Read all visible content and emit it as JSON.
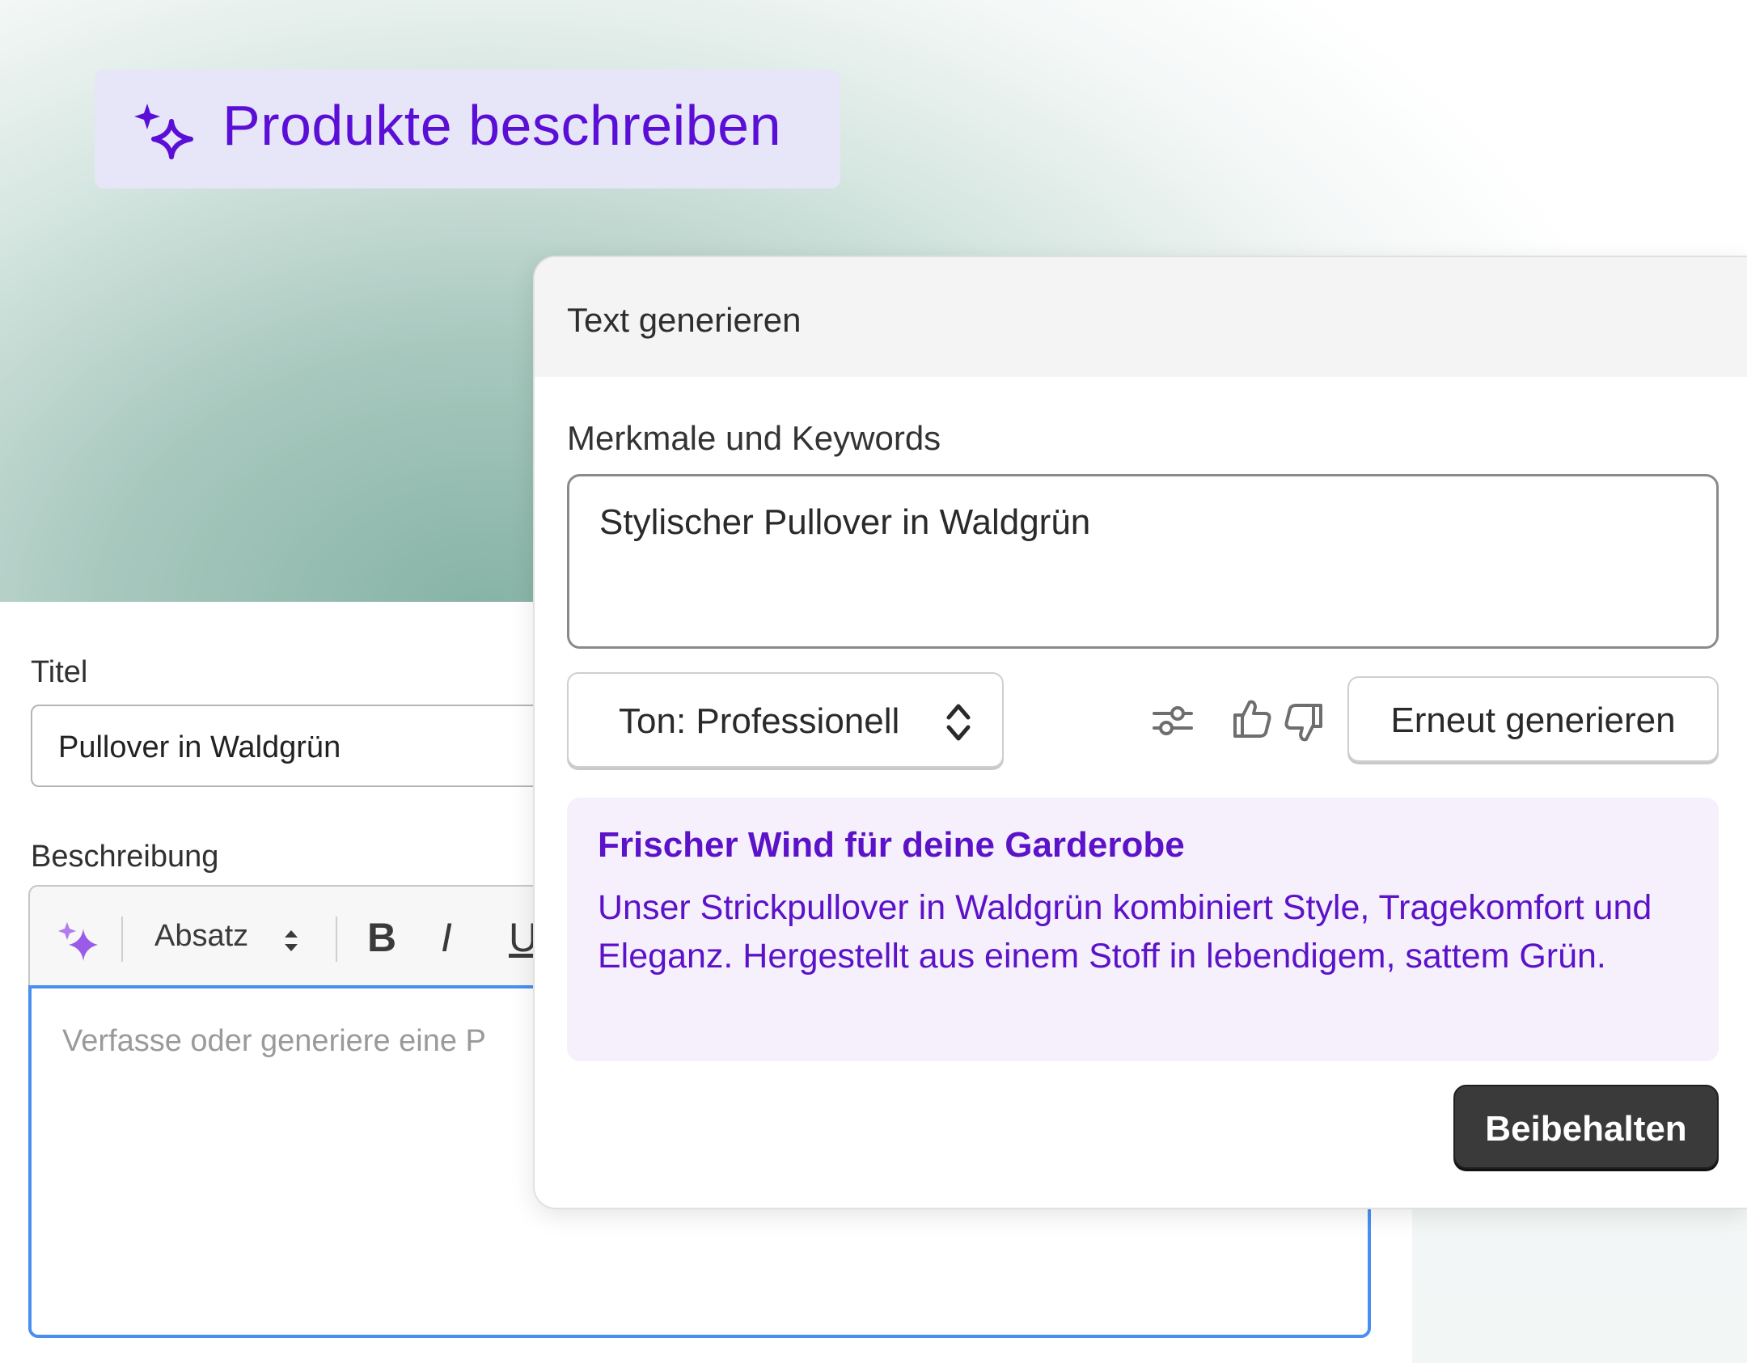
{
  "hero": {
    "title": "Produkte beschreiben",
    "icon": "sparkle-icon",
    "accent_color": "#5b0fd6"
  },
  "form": {
    "title_label": "Titel",
    "title_value": "Pullover in Waldgrün",
    "description_label": "Beschreibung",
    "toolbar": {
      "ai_icon": "sparkle-icon",
      "paragraph_label": "Absatz",
      "bold": "B",
      "italic": "I",
      "underline": "U"
    },
    "editor_placeholder": "Verfasse oder generiere eine P"
  },
  "popover": {
    "header": "Text generieren",
    "keywords_label": "Merkmale und Keywords",
    "keywords_value": "Stylischer Pullover in Waldgrün",
    "tone_label": "Ton: Professionell",
    "icons": [
      "sliders-icon",
      "thumbs-up-icon",
      "thumbs-down-icon"
    ],
    "regenerate_label": "Erneut generieren",
    "result": {
      "title": "Frischer Wind für deine Garderobe",
      "body": "Unser Strickpullover in Waldgrün kombiniert Style, Tragekomfort und Eleganz. Hergestellt aus einem Stoff in lebendigem, sattem Grün."
    },
    "keep_label": "Beibehalten"
  }
}
